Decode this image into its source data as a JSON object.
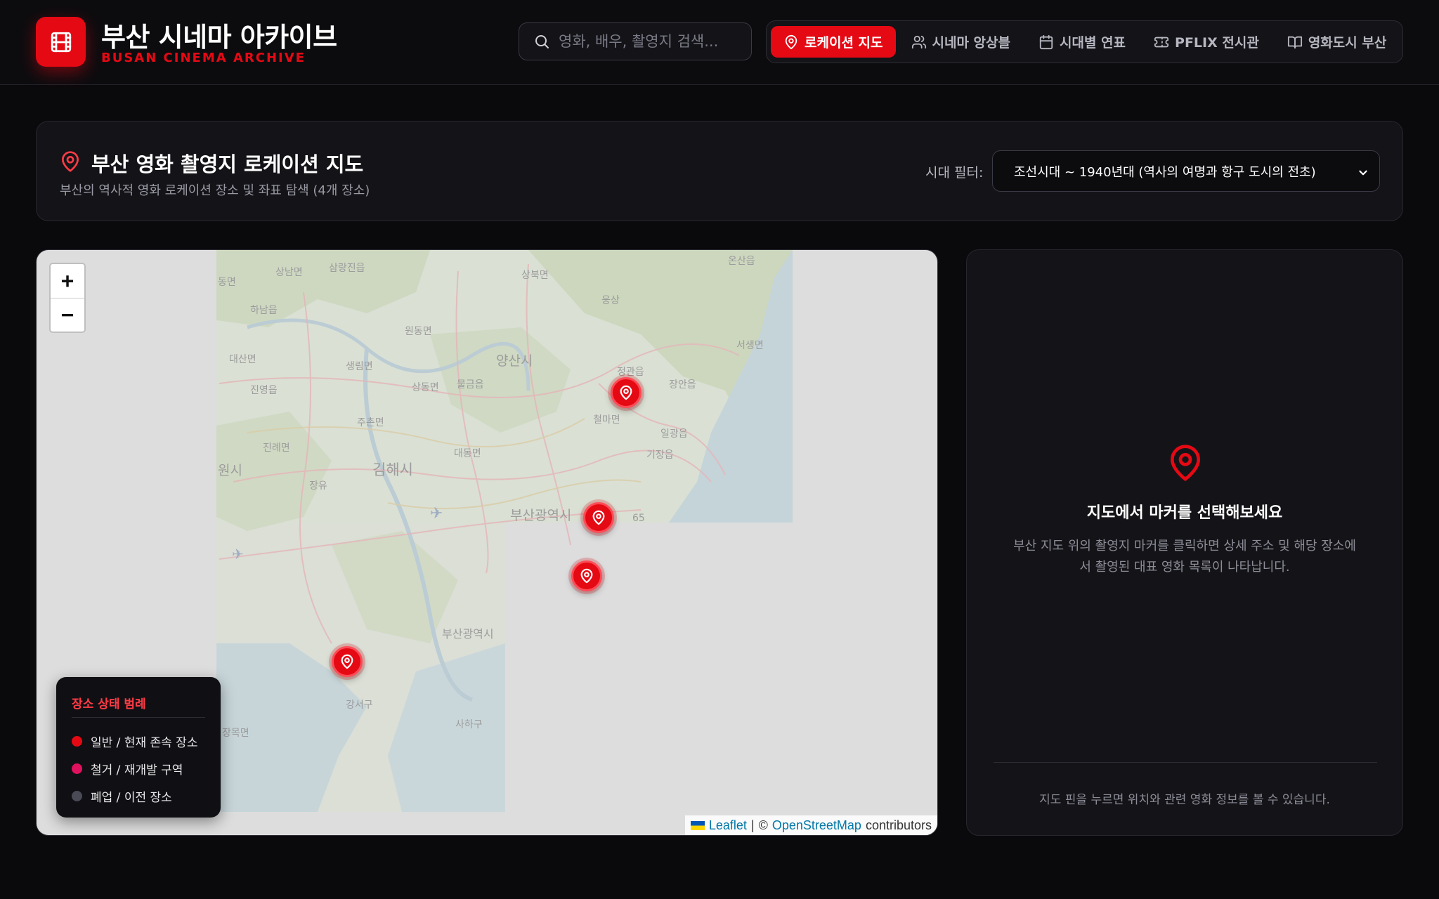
{
  "brand": {
    "title": "부산 시네마 아카이브",
    "subtitle": "BUSAN CINEMA ARCHIVE",
    "logo_icon": "film-icon"
  },
  "search": {
    "placeholder": "영화, 배우, 촬영지 검색..."
  },
  "nav": {
    "items": [
      {
        "label": "로케이션 지도",
        "icon": "map-pin-icon",
        "active": true
      },
      {
        "label": "시네마 앙상블",
        "icon": "users-icon",
        "active": false
      },
      {
        "label": "시대별 연표",
        "icon": "calendar-icon",
        "active": false
      },
      {
        "label": "PFLIX 전시관",
        "icon": "ticket-icon",
        "active": false
      },
      {
        "label": "영화도시 부산",
        "icon": "book-icon",
        "active": false
      }
    ]
  },
  "page": {
    "title": "부산 영화 촬영지 로케이션 지도",
    "subtitle": "부산의 역사적 영화 로케이션 장소 및 좌표 탐색 (4개 장소)",
    "filter_label": "시대 필터:",
    "filter_value": "조선시대 ~ 1940년대 (역사의 여명과 항구 도시의 전초)"
  },
  "map": {
    "zoom_in": "+",
    "zoom_out": "−",
    "place_labels": [
      "양산시",
      "김해시",
      "부산광역시",
      "부산광역시",
      "원시",
      "서생면",
      "기장읍",
      "일광읍",
      "철마면",
      "정관읍",
      "장안읍",
      "웅상",
      "상북면",
      "원동면",
      "물금읍",
      "상동면",
      "생림면",
      "진영읍",
      "대산면",
      "하남읍",
      "삼랑진읍",
      "상남면",
      "동면",
      "진례면",
      "장유",
      "대동면",
      "주촌면",
      "강서구",
      "사하구",
      "장목면",
      "온산읍",
      "65"
    ],
    "marker_count": 4,
    "attribution": {
      "leaflet": "Leaflet",
      "separator": "|",
      "copyright": "©",
      "osm": "OpenStreetMap",
      "contributors": "contributors"
    },
    "legend": {
      "title": "장소 상태 범례",
      "items": [
        {
          "label": "일반 / 현재 존속 장소",
          "color": "#e50914"
        },
        {
          "label": "철거 / 재개발 구역",
          "color": "#e0115f"
        },
        {
          "label": "폐업 / 이전 장소",
          "color": "#4a4a56"
        }
      ]
    }
  },
  "info": {
    "title": "지도에서 마커를 선택해보세요",
    "description": "부산 지도 위의 촬영지 마커를 클릭하면 상세 주소 및 해당 장소에서 촬영된 대표 영화 목록이 나타납니다.",
    "footer": "지도 핀을 누르면 위치와 관련 영화 정보를 볼 수 있습니다."
  },
  "colors": {
    "accent": "#e50914",
    "background": "#0a0a0c",
    "panel": "#141418"
  }
}
